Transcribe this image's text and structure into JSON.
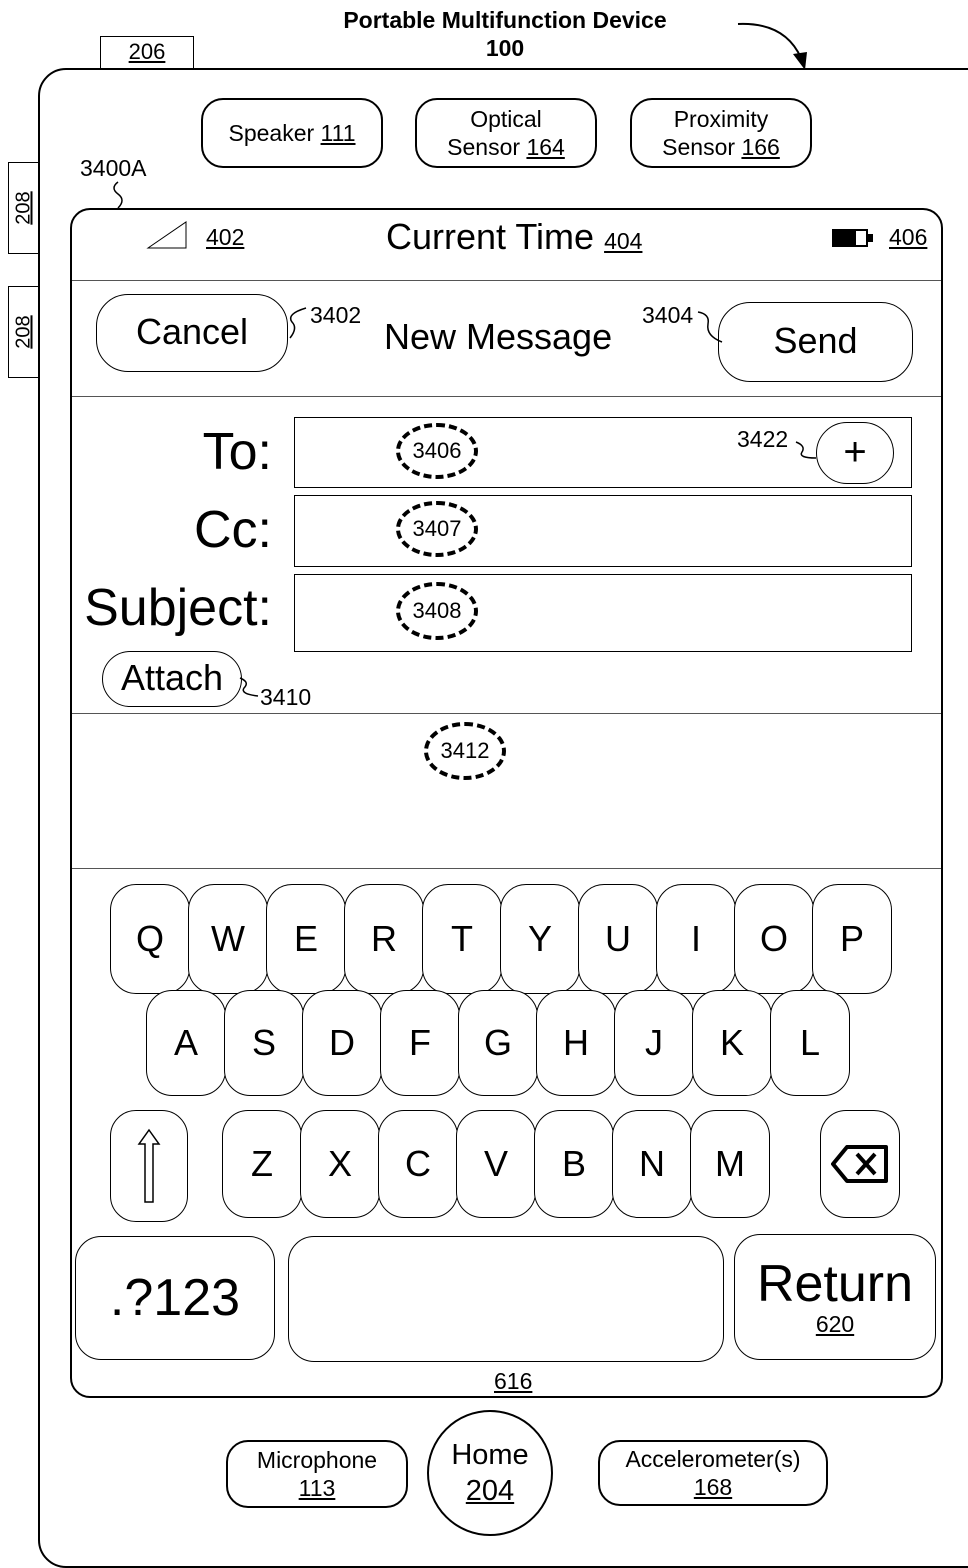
{
  "figure": {
    "device_title": "Portable Multifunction Device",
    "device_number": "100",
    "ref_206": "206",
    "ref_208_a": "208",
    "ref_208_b": "208",
    "ref_3400a": "3400A"
  },
  "hardware_top": {
    "speaker": {
      "label": "Speaker",
      "num": "111"
    },
    "optical": {
      "label1": "Optical",
      "label2": "Sensor",
      "num": "164"
    },
    "proximity": {
      "label1": "Proximity",
      "label2": "Sensor",
      "num": "166"
    }
  },
  "status_bar": {
    "signal_ref": "402",
    "time_label": "Current Time",
    "time_ref": "404",
    "battery_ref": "406"
  },
  "nav": {
    "cancel": "Cancel",
    "cancel_ref": "3402",
    "title": "New Message",
    "send_ref": "3404",
    "send": "Send"
  },
  "fields": {
    "to_label": "To:",
    "to_ref": "3406",
    "add_ref": "3422",
    "add_symbol": "+",
    "cc_label": "Cc:",
    "cc_ref": "3407",
    "subject_label": "Subject:",
    "subject_ref": "3408",
    "attach": "Attach",
    "attach_ref": "3410"
  },
  "body_ref": "3412",
  "keyboard": {
    "row1": [
      "Q",
      "W",
      "E",
      "R",
      "T",
      "Y",
      "U",
      "I",
      "O",
      "P"
    ],
    "row2": [
      "A",
      "S",
      "D",
      "F",
      "G",
      "H",
      "J",
      "K",
      "L"
    ],
    "row3": [
      "Z",
      "X",
      "C",
      "V",
      "B",
      "N",
      "M"
    ],
    "shift_icon": "shift-arrow",
    "backspace_icon": "backspace",
    "numbers": ".?123",
    "return": "Return",
    "return_ref": "620",
    "keyboard_ref": "616"
  },
  "hardware_bottom": {
    "microphone": {
      "label": "Microphone",
      "num": "113"
    },
    "home": {
      "label": "Home",
      "num": "204"
    },
    "accelerometer": {
      "label": "Accelerometer(s)",
      "num": "168"
    }
  }
}
